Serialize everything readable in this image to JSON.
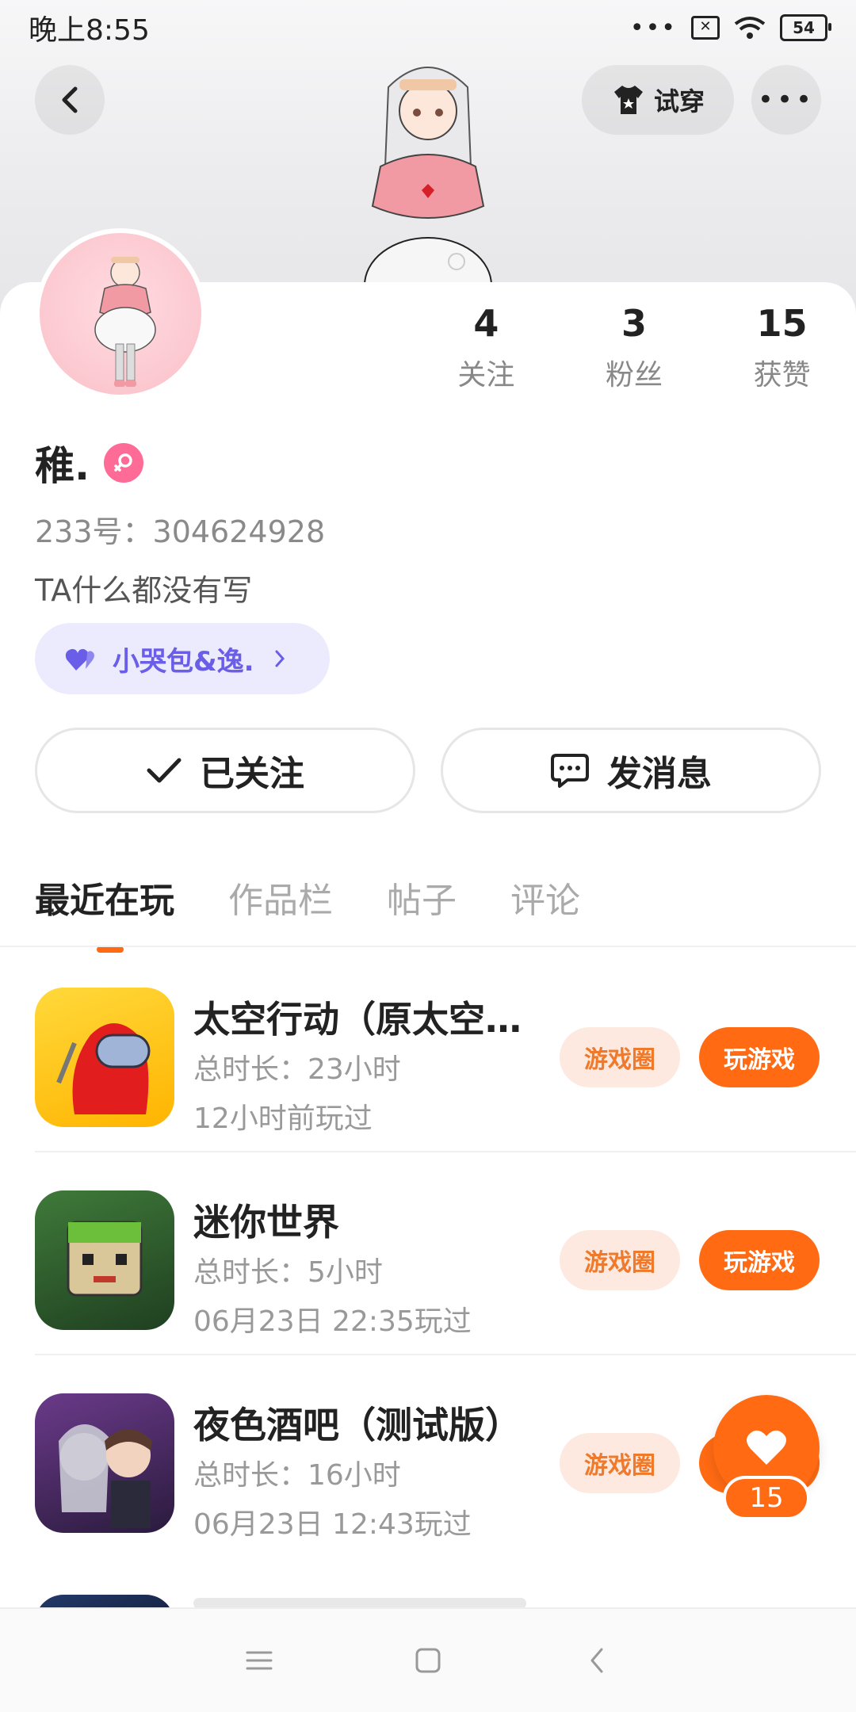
{
  "status_bar": {
    "time": "晚上8:55",
    "battery": "54"
  },
  "header": {
    "try_on_label": "试穿"
  },
  "profile": {
    "username": "稚.",
    "uid": "233号：304624928",
    "bio": "TA什么都没有写",
    "couple_tag": "小哭包&逸."
  },
  "stats": [
    {
      "value": "4",
      "label": "关注"
    },
    {
      "value": "3",
      "label": "粉丝"
    },
    {
      "value": "15",
      "label": "获赞"
    }
  ],
  "actions": {
    "follow_label": "已关注",
    "message_label": "发消息"
  },
  "tabs": [
    {
      "label": "最近在玩",
      "active": true
    },
    {
      "label": "作品栏",
      "active": false
    },
    {
      "label": "帖子",
      "active": false
    },
    {
      "label": "评论",
      "active": false
    }
  ],
  "games": [
    {
      "title": "太空行动（原太空…",
      "duration": "总时长：23小时",
      "last_played": "12小时前玩过",
      "circle_label": "游戏圈",
      "play_label": "玩游戏"
    },
    {
      "title": "迷你世界",
      "duration": "总时长：5小时",
      "last_played": "06月23日 22:35玩过",
      "circle_label": "游戏圈",
      "play_label": "玩游戏"
    },
    {
      "title": "夜色酒吧（测试版）",
      "duration": "总时长：16小时",
      "last_played": "06月23日 12:43玩过",
      "circle_label": "游戏圈",
      "play_label": "玩游戏"
    }
  ],
  "like_fab": {
    "count": "15"
  },
  "colors": {
    "accent": "#ff6a13",
    "chip_bg": "#fde9df",
    "couple_purple": "#6a5ee8"
  }
}
